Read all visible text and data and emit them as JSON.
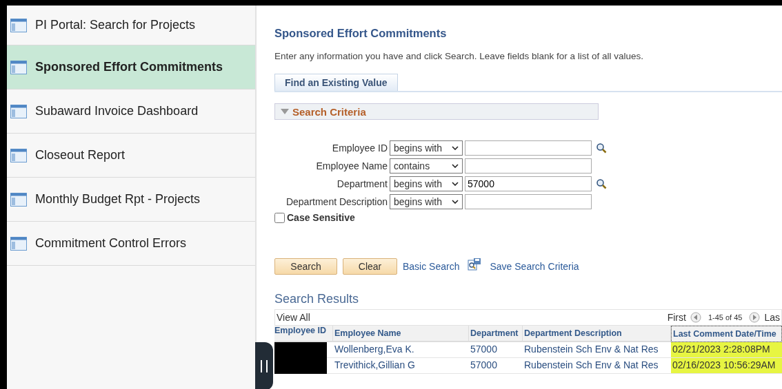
{
  "sidebar": {
    "items": [
      {
        "label": "PI Portal: Search for Projects",
        "selected": false
      },
      {
        "label": "Sponsored Effort Commitments",
        "selected": true
      },
      {
        "label": "Subaward Invoice Dashboard",
        "selected": false
      },
      {
        "label": "Closeout Report",
        "selected": false
      },
      {
        "label": "Monthly Budget Rpt - Projects",
        "selected": false
      },
      {
        "label": "Commitment Control Errors",
        "selected": false
      }
    ]
  },
  "page": {
    "title": "Sponsored Effort Commitments",
    "instructions": "Enter any information you have and click Search. Leave fields blank for a list of all values."
  },
  "tabs": [
    {
      "label": "Find an Existing Value"
    }
  ],
  "search_criteria": {
    "title": "Search Criteria",
    "expanded": true,
    "fields": [
      {
        "label": "Employee ID",
        "operator": "begins with",
        "lookup": true
      },
      {
        "label": "Employee Name",
        "operator": "contains",
        "lookup": false
      },
      {
        "label": "Department",
        "operator": "begins with",
        "value": "57000",
        "lookup": true
      },
      {
        "label": "Department Description",
        "operator": "begins with",
        "lookup": false
      }
    ],
    "case_sensitive": {
      "label": "Case Sensitive",
      "checked": false
    }
  },
  "buttons": [
    "Search",
    "Clear"
  ],
  "links": [
    "Basic Search",
    "Save Search Criteria"
  ],
  "results": {
    "title": "Search Results",
    "view_all": "View All",
    "first": "First",
    "range": "1-45 of 45",
    "last": "Las",
    "columns": [
      "Employee ID",
      "Employee Name",
      "Department",
      "Department Description",
      "Last Comment Date/Time"
    ],
    "rows": [
      {
        "employee_id_redacted": true,
        "name": "Wollenberg,Eva K.",
        "department": "57000",
        "description": "Rubenstein Sch Env & Nat Res",
        "last_comment": "02/21/2023  2:28:08PM"
      },
      {
        "employee_id_redacted": true,
        "name": "Trevithick,Gillian G",
        "department": "57000",
        "description": "Rubenstein Sch Env & Nat Res",
        "last_comment": "02/16/2023 10:56:29AM"
      }
    ]
  }
}
